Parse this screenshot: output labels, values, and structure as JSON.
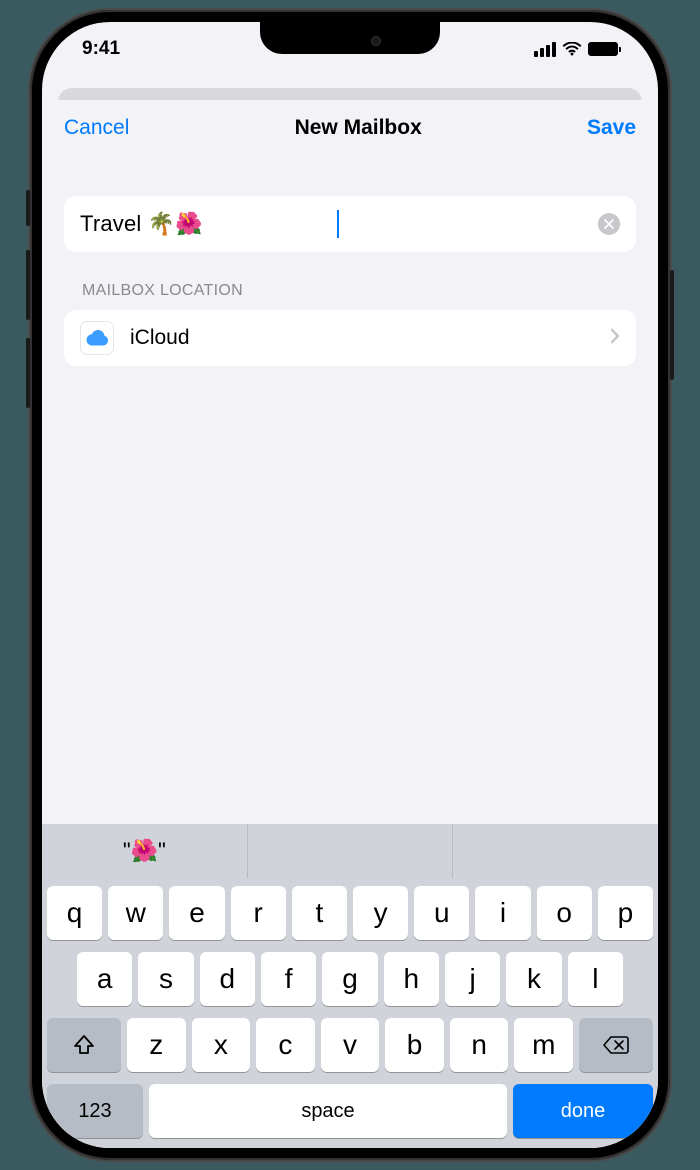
{
  "status": {
    "time": "9:41"
  },
  "nav": {
    "cancel": "Cancel",
    "title": "New Mailbox",
    "save": "Save"
  },
  "input": {
    "value": "Travel 🌴🌺"
  },
  "location": {
    "section_header": "MAILBOX LOCATION",
    "value": "iCloud"
  },
  "suggestions": {
    "item1": "\"🌺\"",
    "item2": "",
    "item3": ""
  },
  "keys": {
    "row1": {
      "k0": "q",
      "k1": "w",
      "k2": "e",
      "k3": "r",
      "k4": "t",
      "k5": "y",
      "k6": "u",
      "k7": "i",
      "k8": "o",
      "k9": "p"
    },
    "row2": {
      "k0": "a",
      "k1": "s",
      "k2": "d",
      "k3": "f",
      "k4": "g",
      "k5": "h",
      "k6": "j",
      "k7": "k",
      "k8": "l"
    },
    "row3": {
      "k0": "z",
      "k1": "x",
      "k2": "c",
      "k3": "v",
      "k4": "b",
      "k5": "n",
      "k6": "m"
    },
    "num": "123",
    "space": "space",
    "done": "done"
  }
}
